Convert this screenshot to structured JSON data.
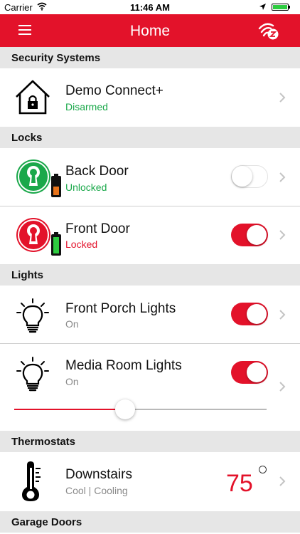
{
  "status_bar": {
    "carrier": "Carrier",
    "time": "11:46 AM"
  },
  "header": {
    "title": "Home"
  },
  "sections": {
    "security": "Security Systems",
    "locks": "Locks",
    "lights": "Lights",
    "thermostats": "Thermostats",
    "garage": "Garage Doors"
  },
  "security_system": {
    "name": "Demo Connect+",
    "state": "Disarmed"
  },
  "locks": [
    {
      "name": "Back Door",
      "state": "Unlocked",
      "toggle_on": false
    },
    {
      "name": "Front Door",
      "state": "Locked",
      "toggle_on": true
    }
  ],
  "lights": [
    {
      "name": "Front Porch Lights",
      "state": "On",
      "toggle_on": true
    },
    {
      "name": "Media Room Lights",
      "state": "On",
      "toggle_on": true,
      "dimmer_level": 0.44
    }
  ],
  "thermostat": {
    "name": "Downstairs",
    "state": "Cool | Cooling",
    "temperature": "75"
  },
  "colors": {
    "brand_red": "#e3122a",
    "status_green": "#1aa84a",
    "status_red": "#e3122a",
    "section_bg": "#e6e6e6"
  },
  "icons": {
    "menu": "hamburger-menu-icon",
    "z_wave": "z-wave-signal-icon",
    "security": "house-lock-icon",
    "lock_unlocked": "green-keyhole-icon",
    "lock_locked": "red-keyhole-icon",
    "light": "lightbulb-icon",
    "thermostat": "thermometer-icon",
    "chevron": "chevron-right-icon"
  }
}
